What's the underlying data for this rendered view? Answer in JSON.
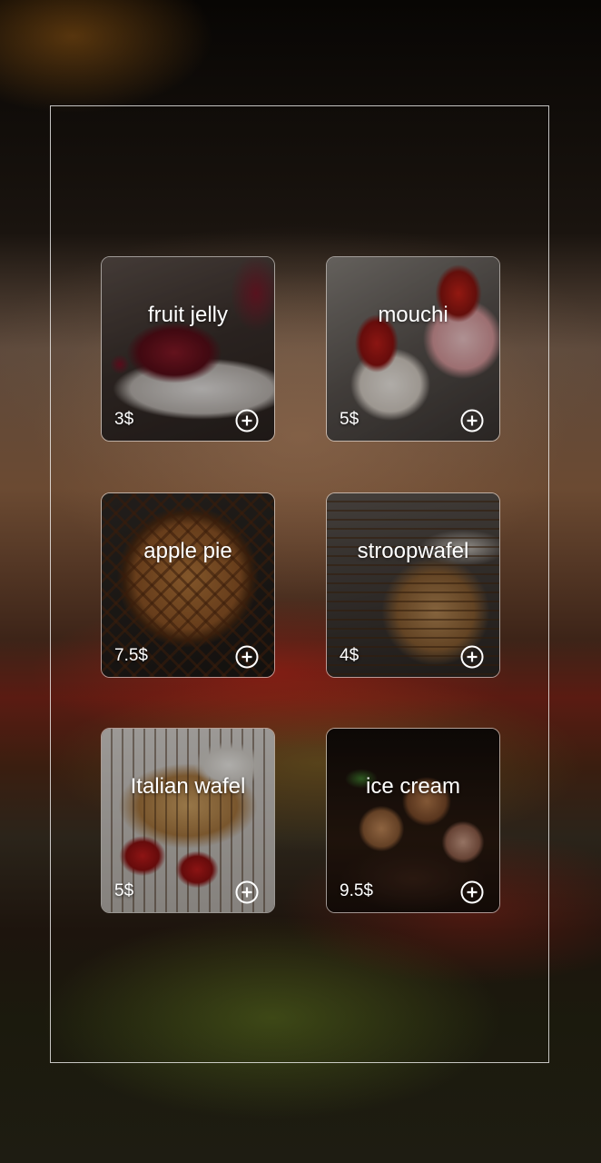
{
  "menu": {
    "items": [
      {
        "name": "fruit jelly",
        "price": "3$",
        "add_icon": "plus-circle-icon"
      },
      {
        "name": "mouchi",
        "price": "5$",
        "add_icon": "plus-circle-icon"
      },
      {
        "name": "apple pie",
        "price": "7.5$",
        "add_icon": "plus-circle-icon"
      },
      {
        "name": "stroopwafel",
        "price": "4$",
        "add_icon": "plus-circle-icon"
      },
      {
        "name": "Italian wafel",
        "price": "5$",
        "add_icon": "plus-circle-icon"
      },
      {
        "name": "ice cream",
        "price": "9.5$",
        "add_icon": "plus-circle-icon"
      }
    ]
  },
  "colors": {
    "text": "#ffffff",
    "card_border": "#ffffff",
    "frame_border": "#ffffff"
  }
}
